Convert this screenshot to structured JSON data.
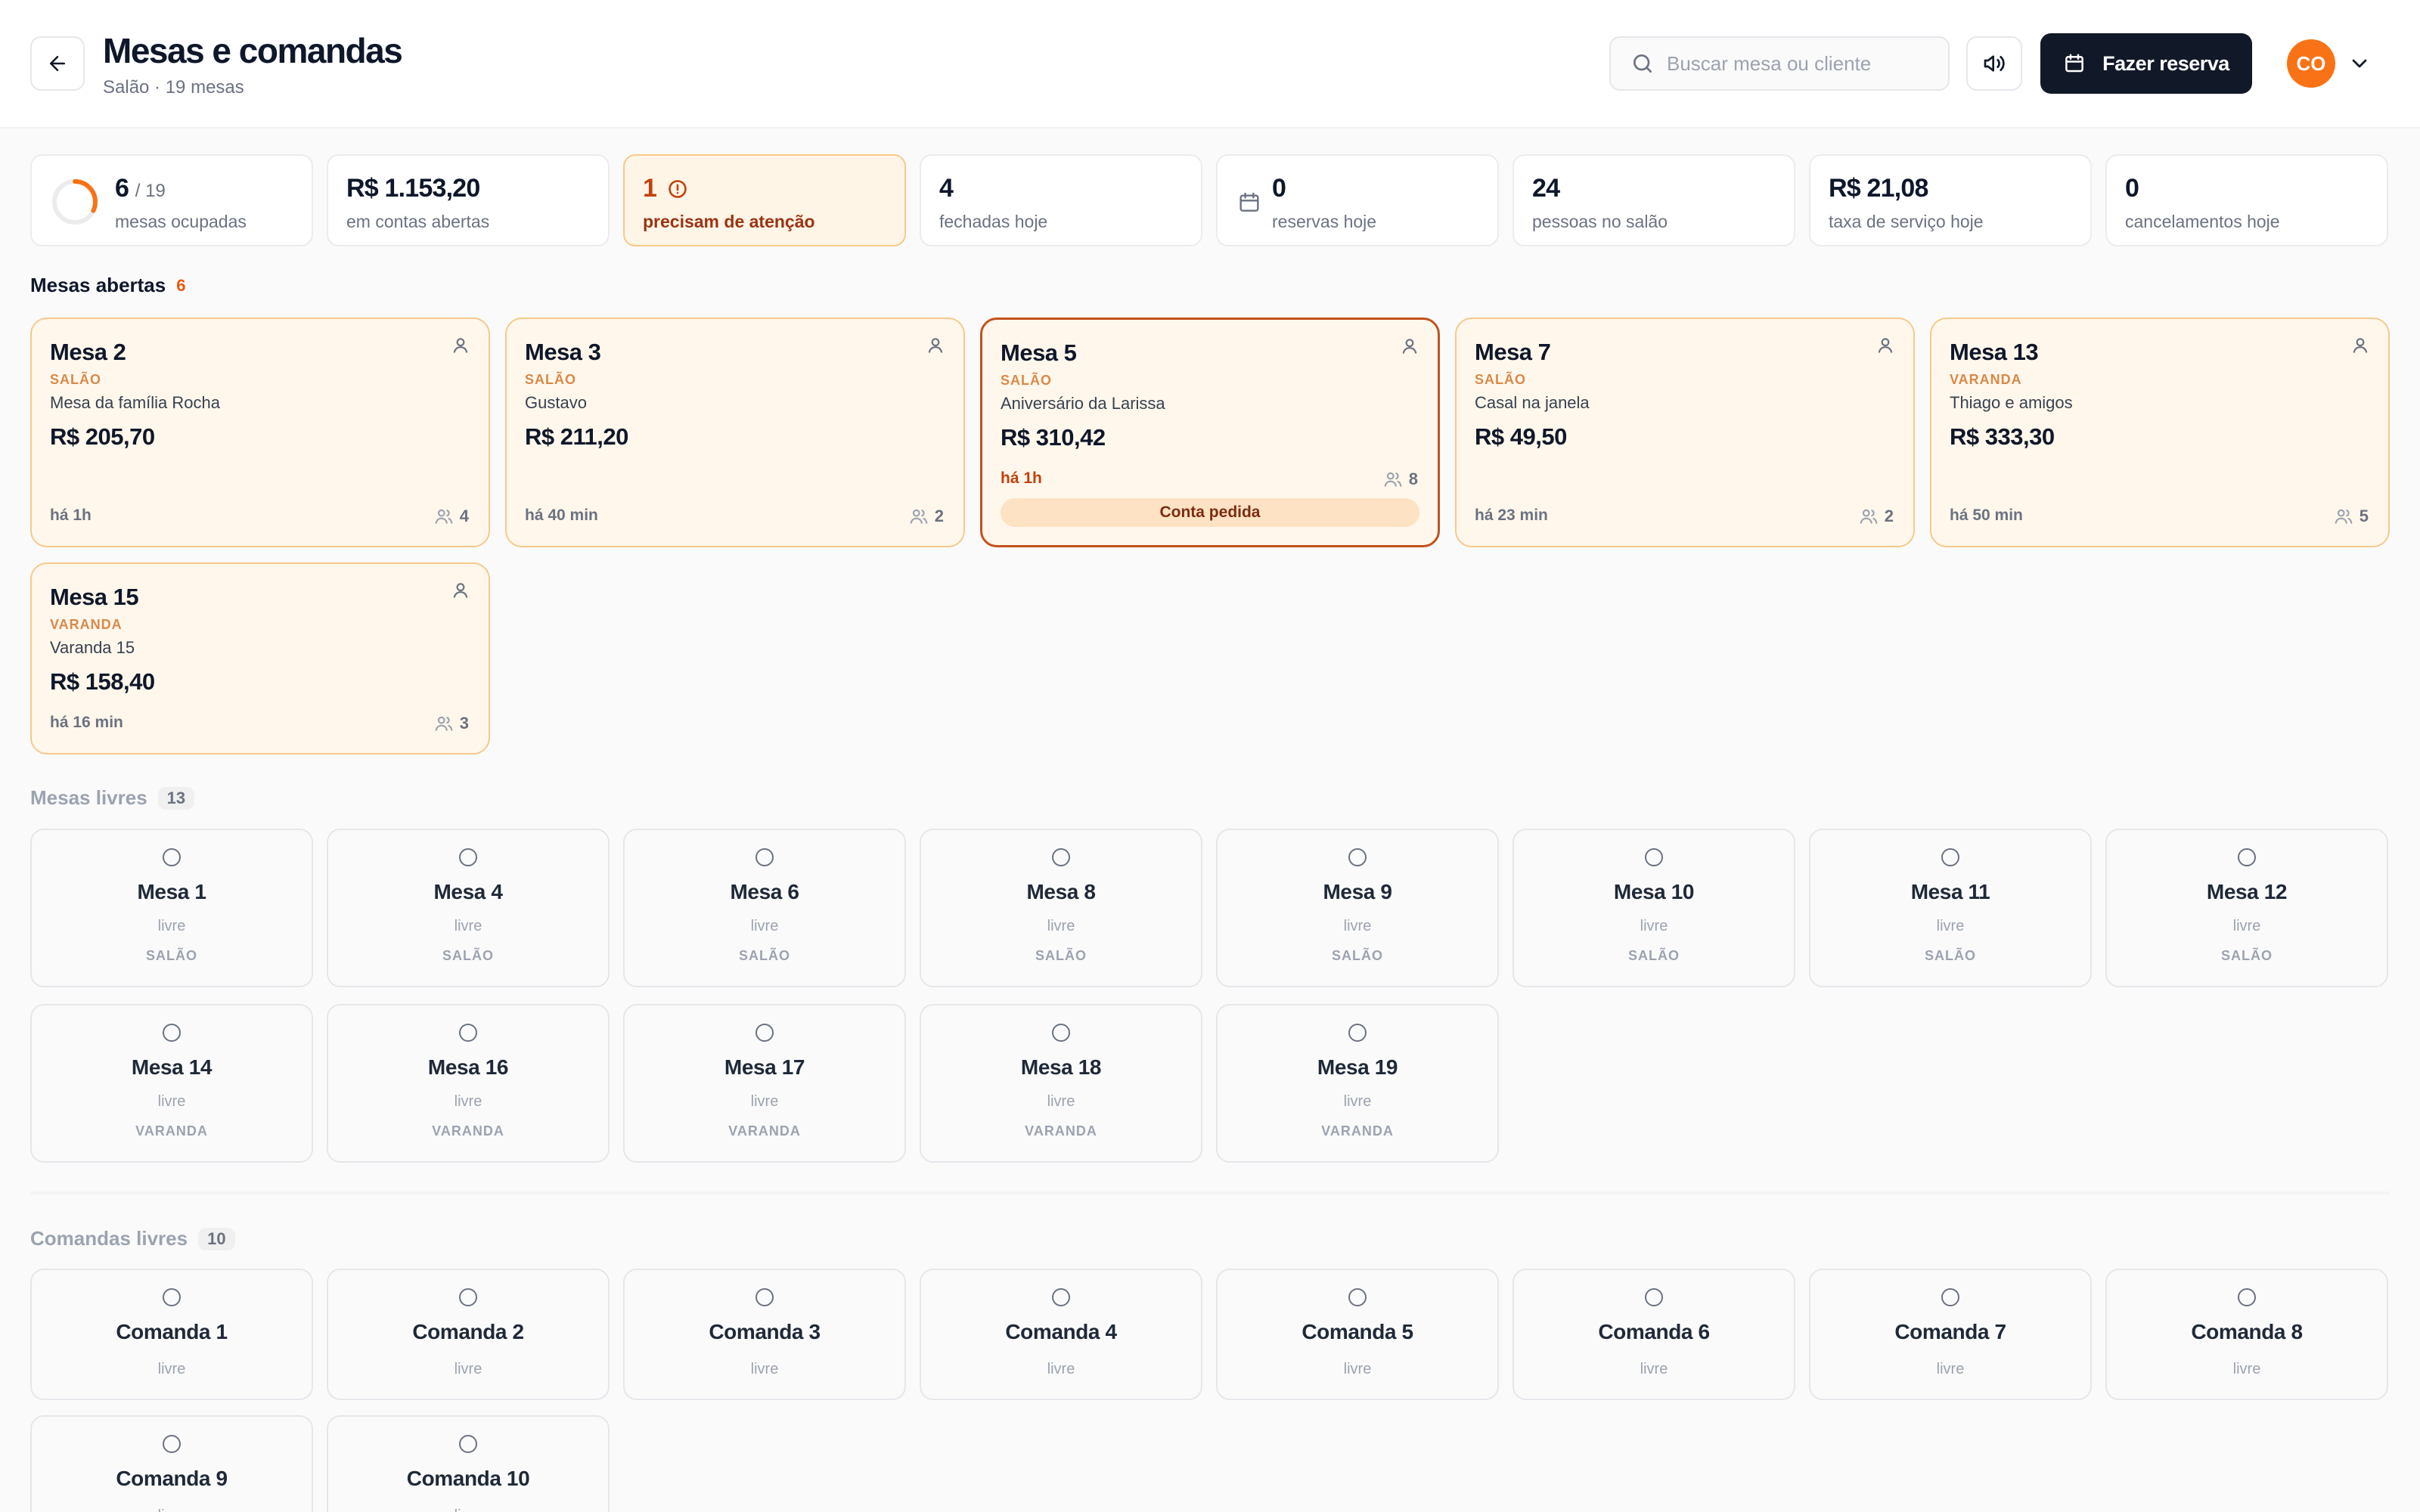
{
  "header": {
    "back_icon": "arrow-left-icon",
    "title": "Mesas e comandas",
    "subtitle": "Salão · 19 mesas",
    "search_placeholder": "Buscar mesa ou cliente",
    "sound_icon": "volume-icon",
    "reserve_label": "Fazer reserva",
    "avatar_initials": "CO"
  },
  "colors": {
    "accent": "#f97316",
    "primary_dark": "#111827",
    "open_card_bg": "#fff7eb",
    "open_card_border": "#f6c98b",
    "alert": "#c2410c"
  },
  "stats": [
    {
      "value": "6",
      "sub": "/ 19",
      "label": "mesas ocupadas",
      "ring_fraction": 0.32
    },
    {
      "value": "R$ 1.153,20",
      "label": "em contas abertas"
    },
    {
      "value": "1",
      "label": "precisam de atenção",
      "icon": "alert-circle-icon"
    },
    {
      "value": "4",
      "label": "fechadas hoje"
    },
    {
      "value": "0",
      "label": "reservas hoje",
      "icon": "calendar-icon"
    },
    {
      "value": "24",
      "label": "pessoas no salão"
    },
    {
      "value": "R$ 21,08",
      "label": "taxa de serviço hoje"
    },
    {
      "value": "0",
      "label": "cancelamentos hoje"
    }
  ],
  "open_section": {
    "title": "Mesas abertas",
    "count": "6"
  },
  "open_tables": [
    {
      "name": "Mesa 2",
      "zone": "SALÃO",
      "guest": "Mesa da família Rocha",
      "amount": "R$ 205,70",
      "elapsed": "há 1h",
      "people": "4"
    },
    {
      "name": "Mesa 3",
      "zone": "SALÃO",
      "guest": "Gustavo",
      "amount": "R$ 211,20",
      "elapsed": "há 40 min",
      "people": "2"
    },
    {
      "name": "Mesa 5",
      "zone": "SALÃO",
      "guest": "Aniversário da Larissa",
      "amount": "R$ 310,42",
      "elapsed": "há 1h",
      "people": "8",
      "status": "Conta pedida"
    },
    {
      "name": "Mesa 7",
      "zone": "SALÃO",
      "guest": "Casal na janela",
      "amount": "R$ 49,50",
      "elapsed": "há 23 min",
      "people": "2"
    },
    {
      "name": "Mesa 13",
      "zone": "VARANDA",
      "guest": "Thiago e amigos",
      "amount": "R$ 333,30",
      "elapsed": "há 50 min",
      "people": "5"
    },
    {
      "name": "Mesa 15",
      "zone": "VARANDA",
      "guest": "Varanda 15",
      "amount": "R$ 158,40",
      "elapsed": "há 16 min",
      "people": "3"
    }
  ],
  "free_section": {
    "title": "Mesas livres",
    "count": "13"
  },
  "free_tables": [
    {
      "name": "Mesa 1",
      "status": "livre",
      "zone": "SALÃO"
    },
    {
      "name": "Mesa 4",
      "status": "livre",
      "zone": "SALÃO"
    },
    {
      "name": "Mesa 6",
      "status": "livre",
      "zone": "SALÃO"
    },
    {
      "name": "Mesa 8",
      "status": "livre",
      "zone": "SALÃO"
    },
    {
      "name": "Mesa 9",
      "status": "livre",
      "zone": "SALÃO"
    },
    {
      "name": "Mesa 10",
      "status": "livre",
      "zone": "SALÃO"
    },
    {
      "name": "Mesa 11",
      "status": "livre",
      "zone": "SALÃO"
    },
    {
      "name": "Mesa 12",
      "status": "livre",
      "zone": "SALÃO"
    },
    {
      "name": "Mesa 14",
      "status": "livre",
      "zone": "VARANDA"
    },
    {
      "name": "Mesa 16",
      "status": "livre",
      "zone": "VARANDA"
    },
    {
      "name": "Mesa 17",
      "status": "livre",
      "zone": "VARANDA"
    },
    {
      "name": "Mesa 18",
      "status": "livre",
      "zone": "VARANDA"
    },
    {
      "name": "Mesa 19",
      "status": "livre",
      "zone": "VARANDA"
    }
  ],
  "comandas_section": {
    "title": "Comandas livres",
    "count": "10"
  },
  "comandas": [
    {
      "name": "Comanda 1",
      "status": "livre"
    },
    {
      "name": "Comanda 2",
      "status": "livre"
    },
    {
      "name": "Comanda 3",
      "status": "livre"
    },
    {
      "name": "Comanda 4",
      "status": "livre"
    },
    {
      "name": "Comanda 5",
      "status": "livre"
    },
    {
      "name": "Comanda 6",
      "status": "livre"
    },
    {
      "name": "Comanda 7",
      "status": "livre"
    },
    {
      "name": "Comanda 8",
      "status": "livre"
    },
    {
      "name": "Comanda 9",
      "status": "livre"
    },
    {
      "name": "Comanda 10",
      "status": "livre"
    }
  ]
}
